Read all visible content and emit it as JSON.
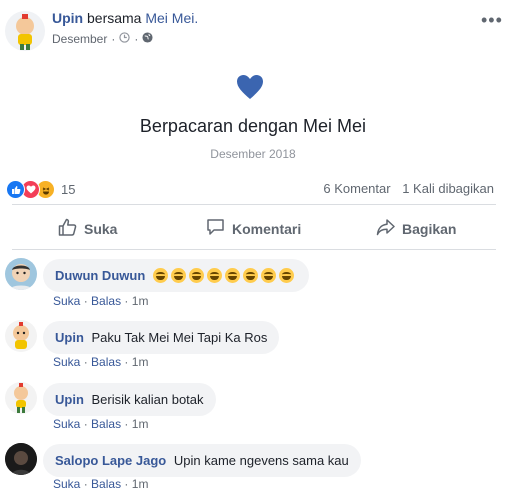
{
  "post": {
    "author": "Upin",
    "with_text": "bersama",
    "tagged": "Mei Mei.",
    "date": "Desember",
    "menu_label": "•••"
  },
  "event": {
    "title": "Berpacaran dengan Mei Mei",
    "date": "Desember 2018"
  },
  "reactions": {
    "count": "15",
    "types": [
      "like-icon",
      "love-icon",
      "haha-icon"
    ],
    "comments_count": "6 Komentar",
    "shares_count": "1 Kali dibagikan"
  },
  "actions": {
    "like": "Suka",
    "comment": "Komentari",
    "share": "Bagikan"
  },
  "comments": [
    {
      "author": "Duwun Duwun",
      "text": "",
      "emoji_count": 8,
      "like": "Suka",
      "reply": "Balas",
      "time": "1m"
    },
    {
      "author": "Upin",
      "text": "Paku Tak Mei Mei Tapi Ka Ros",
      "like": "Suka",
      "reply": "Balas",
      "time": "1m"
    },
    {
      "author": "Upin",
      "text": "Berisik kalian botak",
      "like": "Suka",
      "reply": "Balas",
      "time": "1m"
    },
    {
      "author": "Salopo Lape Jago",
      "text": "Upin kame ngevens sama kau",
      "like": "Suka",
      "reply": "Balas",
      "time": "1m"
    }
  ],
  "separator": "·",
  "colors": {
    "link": "#385898",
    "heart": "#3b65b0",
    "like": "#1877f2",
    "love": "#f33e58",
    "haha": "#f7b125"
  }
}
